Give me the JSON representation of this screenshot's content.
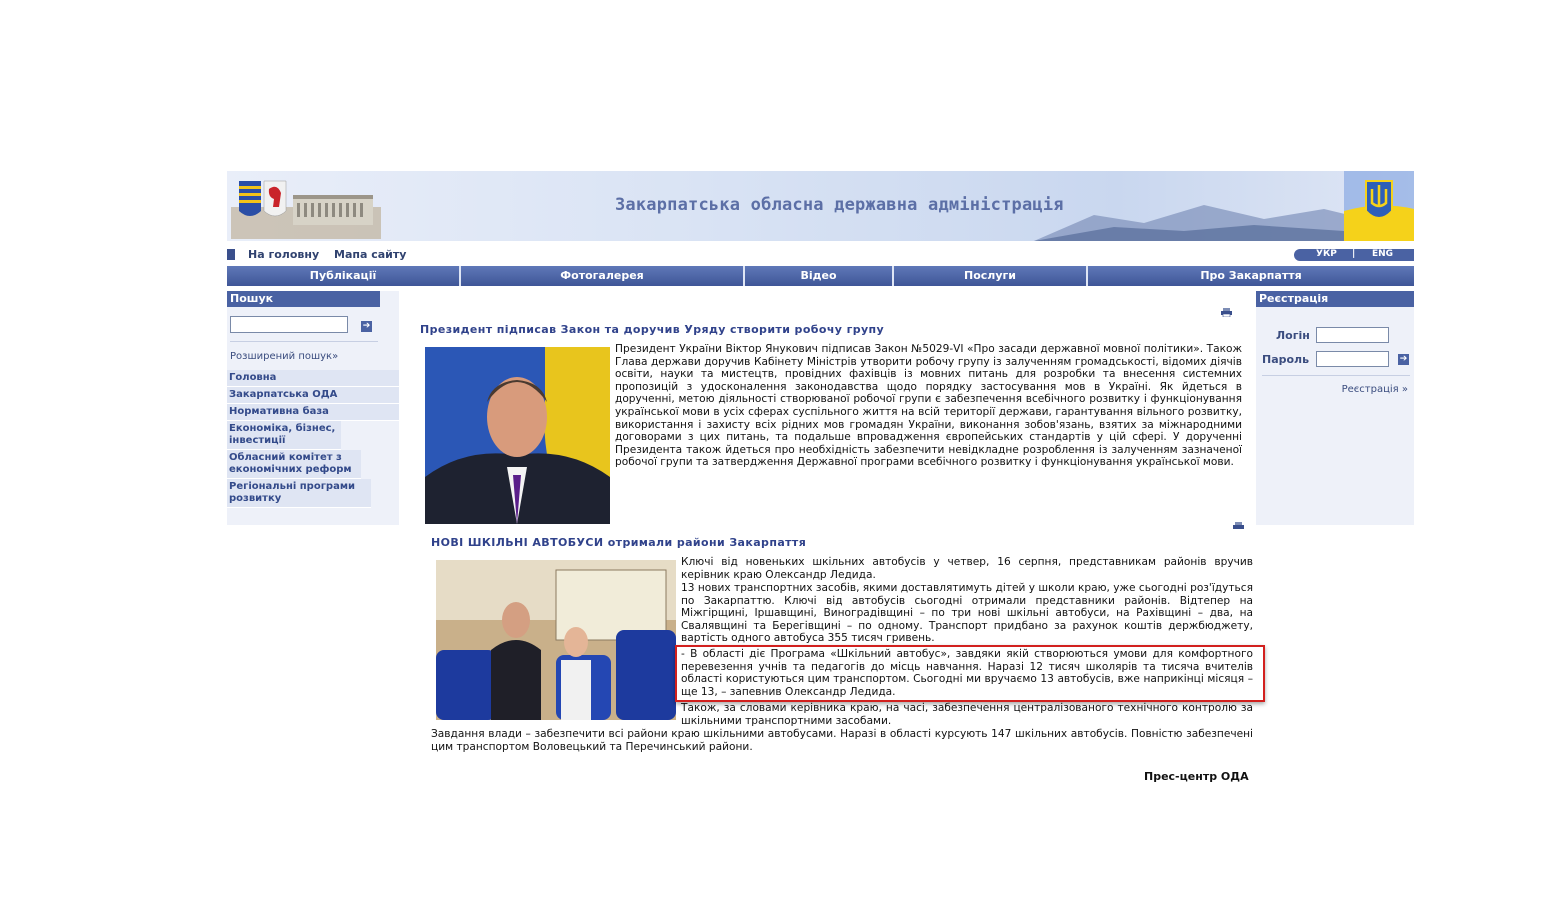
{
  "header": {
    "title": "Закарпатська обласна державна адміністрація",
    "logo_icon": "coat-of-arms-building",
    "flag_icon": "trident-flag-icon"
  },
  "toplinks": {
    "home": "На головну",
    "sitemap": "Мапа сайту",
    "lang_ukr": "УКР",
    "lang_sep": "|",
    "lang_eng": "ENG"
  },
  "nav": [
    "Публікації",
    "Фотогалерея",
    "Відео",
    "Послуги",
    "Про Закарпаття"
  ],
  "left": {
    "search_head": "Пошук",
    "advanced": "Розширений пошук»",
    "go": "➔",
    "menu": [
      "Головна",
      "Закарпатська ОДА",
      "Нормативна база",
      "Економіка, бізнес, інвестиції",
      "Обласний комітет з економічних реформ",
      "Регіональні програми розвитку"
    ]
  },
  "right": {
    "head": "Реєстрація",
    "login_label": "Логін",
    "password_label": "Пароль",
    "register_link": "Реєстрація »",
    "go": "➔"
  },
  "article1": {
    "title": "Президент підписав Закон та доручив Уряду створити робочу групу",
    "text": "Президент України Віктор Янукович підписав Закон №5029-VI «Про засади державної мовної політики». Також Глава держави доручив Кабінету Міністрів утворити робочу групу із залученням громадськості, відомих діячів освіти, науки та мистецтв, провідних фахівців із мовних питань для розробки та внесення системних пропозицій з удосконалення законодавства щодо порядку застосування мов в Україні. Як йдеться в дорученні, метою діяльності створюваної робочої групи є забезпечення всебічного розвитку і функціонування української мови в усіх сферах суспільного життя на всій території держави, гарантування вільного розвитку, використання і захисту всіх рідних мов громадян України, виконання зобов'язань, взятих за міжнародними договорами з цих питань, та подальше впровадження європейських стандартів у цій сфері. У дорученні Президента також йдеться про необхідність забезпечити невідкладне розроблення із залученням зазначеної робочої групи та затвердження Державної програми всебічного розвитку і функціонування української мови."
  },
  "article2": {
    "title": "НОВІ ШКІЛЬНІ АВТОБУСИ отримали райони Закарпаття",
    "p1": "Ключі від новеньких шкільних автобусів у четвер, 16 серпня, представникам районів вручив керівник краю Олександр Ледида.",
    "p2": "13 нових транспортних засобів, якими доставлятимуть дітей у школи краю, уже сьогодні роз'їдуться по Закарпаттю. Ключі від автобусів сьогодні отримали представники районів. Відтепер на Міжгірщині, Іршавщині, Виноградівщині – по три нові шкільні автобуси, на Рахівщині – два, на Свалявщині та Берегівщині – по одному. Транспорт придбано за рахунок коштів держбюджету, вартість одного автобуса 355 тисяч гривень.",
    "p3": "- В області діє Програма «Шкільний автобус», завдяки якій створюються умови для комфортного перевезення учнів та педагогів до місць навчання. Наразі 12 тисяч школярів та тисяча вчителів області користуються цим транспортом. Сьогодні ми вручаємо 13 автобусів, вже наприкінці місяця – ще 13, – запевнив Олександр Ледида.",
    "p4": "Також, за словами керівника краю, на часі, забезпечення централізованого технічного контролю за шкільними транспортними засобами.",
    "p5": "Завдання влади – забезпечити всі райони краю шкільними автобусами. Наразі в області курсують 147 шкільних автобусів. Повністю забезпечені цим транспортом Воловецький та Перечинський райони.",
    "signature": "Прес-центр ОДА"
  },
  "colors": {
    "nav": "#4a62a3",
    "highlight": "#d2201e",
    "title": "#30428b"
  }
}
